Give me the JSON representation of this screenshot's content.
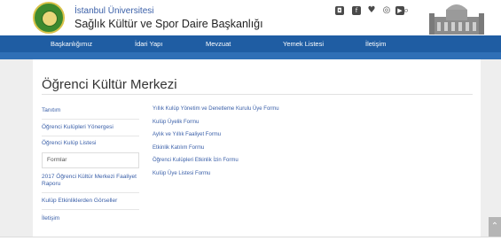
{
  "header": {
    "org_name": "İstanbul Üniversitesi",
    "dept_name": "Sağlık Kültür ve Spor Daire Başkanlığı",
    "icons": [
      "instagram-icon",
      "facebook-icon",
      "twitter-icon",
      "youtube-icon",
      "video-icon",
      "search-icon"
    ]
  },
  "nav": {
    "items": [
      {
        "label": "Başkanlığımız"
      },
      {
        "label": "İdari Yapı"
      },
      {
        "label": "Mevzuat"
      },
      {
        "label": "Yemek Listesi"
      },
      {
        "label": "İletişim"
      }
    ]
  },
  "page": {
    "title": "Öğrenci Kültür Merkezi"
  },
  "sidebar": {
    "items": [
      {
        "label": "Tanıtım"
      },
      {
        "label": "Öğrenci Kulüpleri Yönergesi"
      },
      {
        "label": "Öğrenci Kulüp Listesi"
      },
      {
        "label": "Formlar"
      },
      {
        "label": "2017 Öğrenci Kültür Merkezi Faaliyet Raporu"
      },
      {
        "label": "Kulüp Etkinliklerden Görseller"
      },
      {
        "label": "İletişim"
      }
    ],
    "active_index": 3
  },
  "forms": {
    "links": [
      {
        "label": "Yıllık Kulüp Yönetim ve Denetleme Kurulu Üye Formu"
      },
      {
        "label": "Kulüp Üyelik Formu"
      },
      {
        "label": "Aylık ve Yıllık Faaliyet Formu"
      },
      {
        "label": "Etkinlik Katılım Formu"
      },
      {
        "label": "Öğrenci Kulüpleri Etkinlik İzin Formu"
      },
      {
        "label": "Kulüp Üye Listesi Formu"
      }
    ]
  },
  "colors": {
    "nav_bg": "#1f5da3",
    "link": "#3a5fa8"
  }
}
